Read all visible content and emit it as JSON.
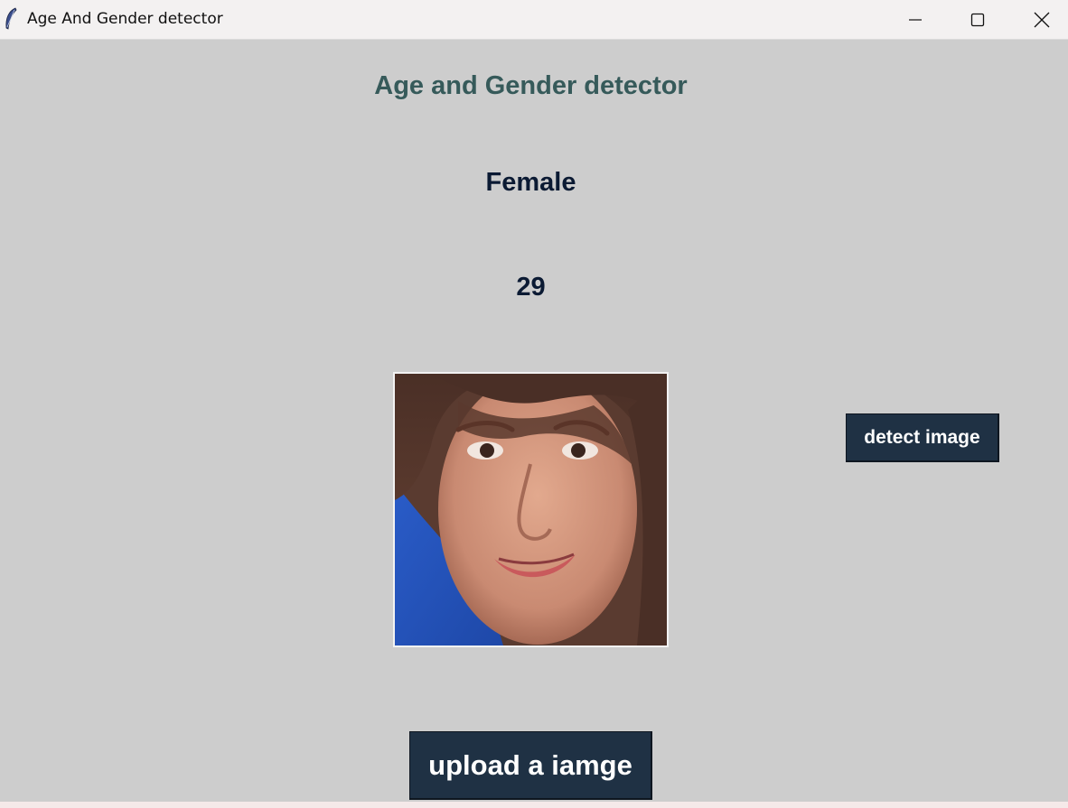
{
  "window": {
    "title": "Age And Gender detector",
    "icon": "feather-icon"
  },
  "controls": {
    "minimize": "minimize-icon",
    "maximize": "maximize-icon",
    "close": "close-icon"
  },
  "main": {
    "heading": "Age and Gender detector",
    "gender": "Female",
    "age": "29",
    "image": "uploaded-face-photo",
    "detect_label": "detect image",
    "upload_label": "upload a iamge"
  },
  "colors": {
    "background": "#cdcdcd",
    "heading": "#365a5a",
    "result_text": "#0b1a33",
    "button_bg": "#1f3144",
    "button_text": "#ffffff"
  }
}
